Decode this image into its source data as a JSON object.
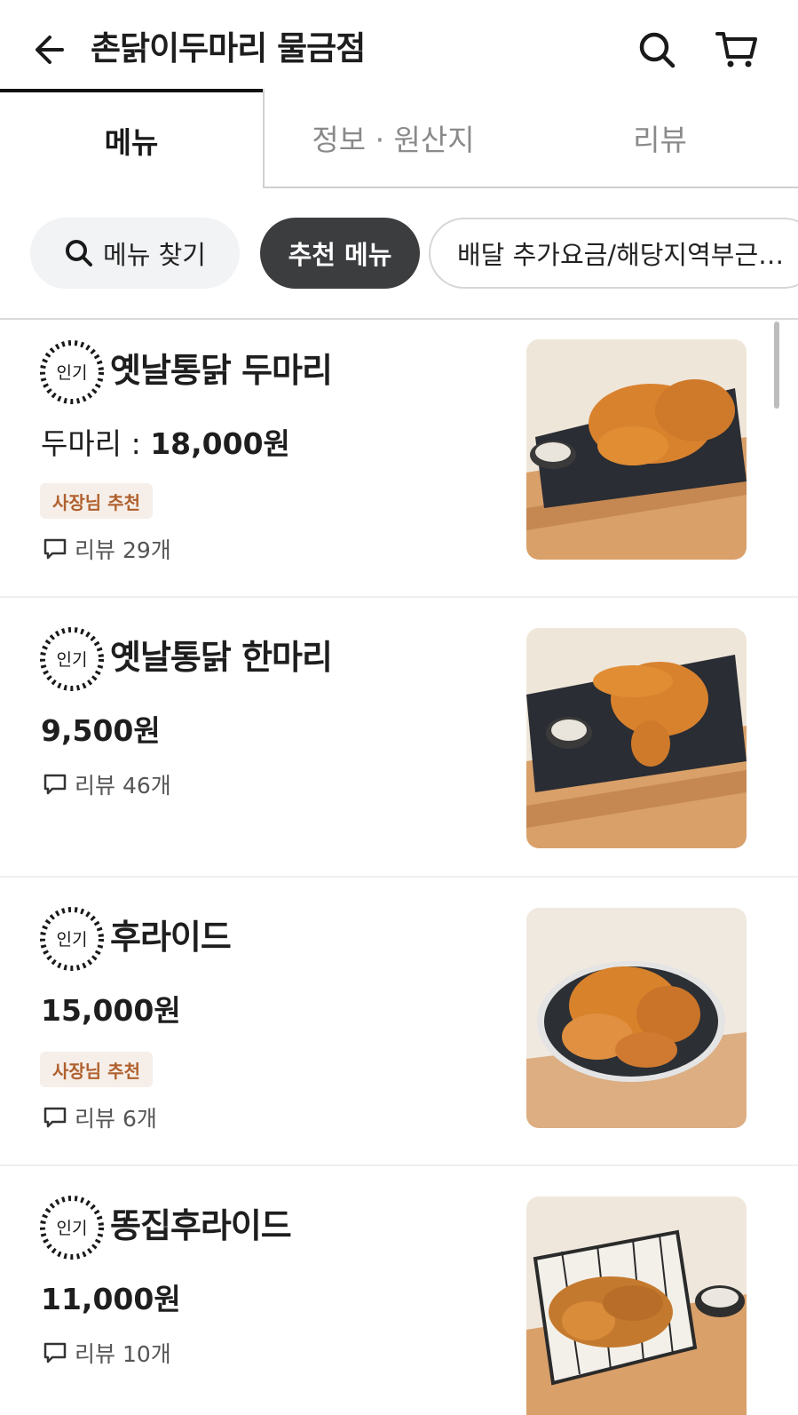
{
  "header": {
    "title": "촌닭이두마리 물금점",
    "icons": {
      "back": "arrow-left-icon",
      "search": "search-icon",
      "cart": "cart-icon"
    }
  },
  "tabs": [
    {
      "label": "메뉴",
      "active": true
    },
    {
      "label": "정보 · 원산지",
      "active": false
    },
    {
      "label": "리뷰",
      "active": false
    }
  ],
  "chips": {
    "search_label": "메뉴 찾기",
    "recommended_label": "추천 메뉴",
    "delivery_fee_label": "배달 추가요금/해당지역부근…"
  },
  "badge_popular": "인기",
  "items": [
    {
      "name": "옛날통닭 두마리",
      "price_prefix": "두마리 : ",
      "price": "18,000원",
      "owner_tag": "사장님 추천",
      "review": "리뷰 29개",
      "image": "whole-roast-chicken-two"
    },
    {
      "name": "옛날통닭 한마리",
      "price_prefix": "",
      "price": "9,500원",
      "owner_tag": "",
      "review": "리뷰 46개",
      "image": "whole-roast-chicken-one"
    },
    {
      "name": "후라이드",
      "price_prefix": "",
      "price": "15,000원",
      "owner_tag": "사장님 추천",
      "review": "리뷰 6개",
      "image": "fried-chicken-plate"
    },
    {
      "name": "똥집후라이드",
      "price_prefix": "",
      "price": "11,000원",
      "owner_tag": "",
      "review": "리뷰 10개",
      "image": "fried-gizzard-basket"
    }
  ],
  "colors": {
    "accent_dark": "#3c3d3f",
    "tag_bg": "#f6eee8",
    "tag_text": "#b0612e"
  }
}
